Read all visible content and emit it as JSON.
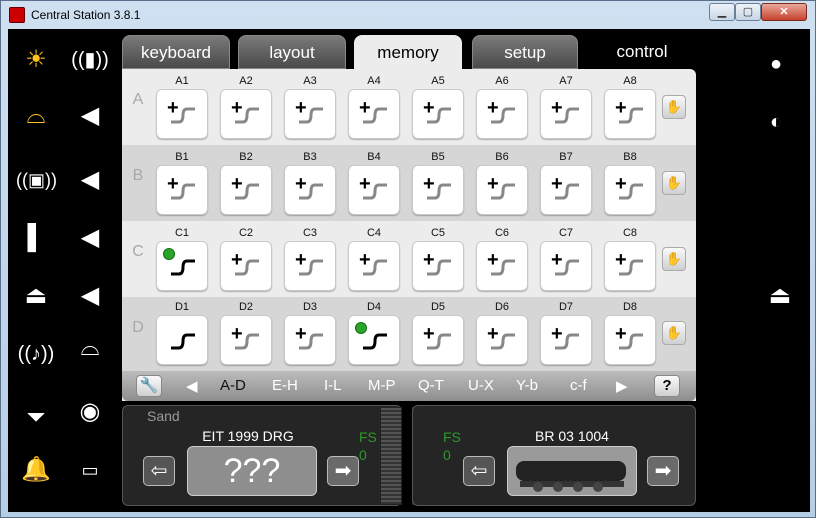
{
  "window": {
    "title": "Central Station 3.8.1",
    "minimize": "▁",
    "maximize": "▢",
    "close": "✕"
  },
  "tabs": [
    {
      "label": "keyboard"
    },
    {
      "label": "layout"
    },
    {
      "label": "memory"
    },
    {
      "label": "setup"
    },
    {
      "label": "control"
    }
  ],
  "memory": {
    "rows": [
      {
        "letter": "A",
        "cells": [
          "A1",
          "A2",
          "A3",
          "A4",
          "A5",
          "A6",
          "A7",
          "A8"
        ]
      },
      {
        "letter": "B",
        "cells": [
          "B1",
          "B2",
          "B3",
          "B4",
          "B5",
          "B6",
          "B7",
          "B8"
        ]
      },
      {
        "letter": "C",
        "cells": [
          "C1",
          "C2",
          "C3",
          "C4",
          "C5",
          "C6",
          "C7",
          "C8"
        ]
      },
      {
        "letter": "D",
        "cells": [
          "D1",
          "D2",
          "D3",
          "D4",
          "D5",
          "D6",
          "D7",
          "D8"
        ]
      }
    ],
    "ranges": [
      "A-D",
      "E-H",
      "I-L",
      "M-P",
      "Q-T",
      "U-X",
      "Y-b",
      "c-f"
    ],
    "active_range": "A-D",
    "help": "?",
    "prev": "◀",
    "next": "▶"
  },
  "loco_left": {
    "function_label": "Sand",
    "name": "EIT 1999 DRG",
    "image_text": "???",
    "fs_label": "FS",
    "fs_value": "0"
  },
  "loco_right": {
    "name": "BR 03 1004",
    "fs_label": "FS",
    "fs_value": "0"
  },
  "colors": {
    "accent": "#ffc21a",
    "active_green": "#2aa52a",
    "fs_green": "#2a9a2a"
  }
}
